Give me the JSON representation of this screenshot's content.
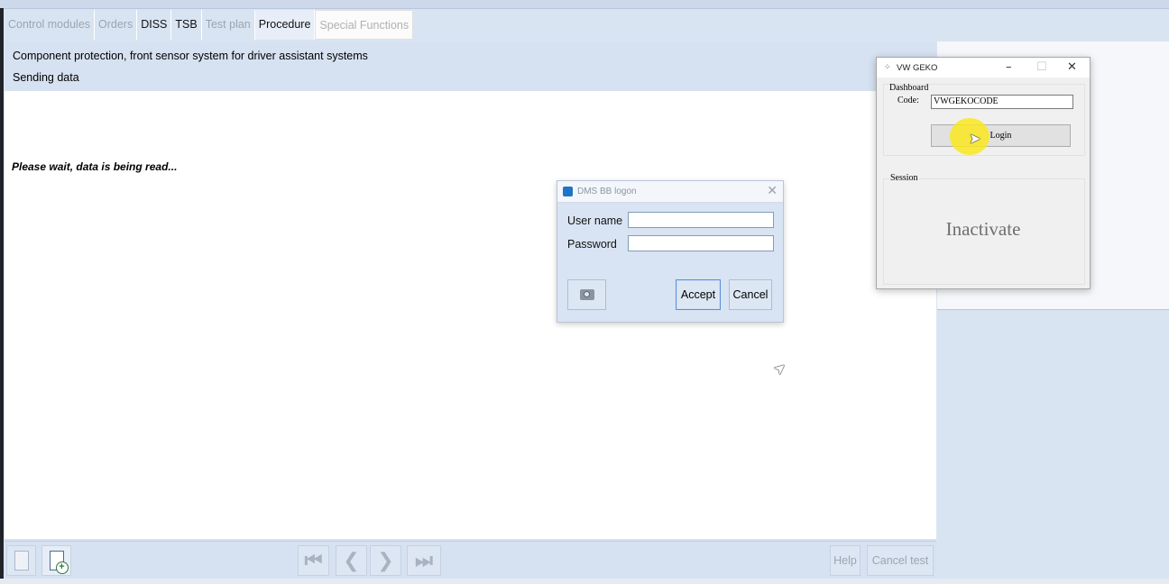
{
  "tabs": [
    {
      "label": "Control modules",
      "state": "disabled"
    },
    {
      "label": "Orders",
      "state": "disabled"
    },
    {
      "label": "DISS",
      "state": "enabled"
    },
    {
      "label": "TSB",
      "state": "enabled"
    },
    {
      "label": "Test plan",
      "state": "disabled"
    },
    {
      "label": "Procedure",
      "state": "active"
    },
    {
      "label": "Special Functions",
      "state": "disabled"
    }
  ],
  "header": {
    "line1": "Component protection, front sensor system for driver assistant systems",
    "line2": "Sending data"
  },
  "content": {
    "wait_message": "Please wait, data is being read..."
  },
  "toolbar": {
    "help_label": "Help",
    "cancel_test_label": "Cancel test"
  },
  "dms_dialog": {
    "title": "DMS BB logon",
    "username_label": "User name",
    "username_value": "",
    "password_label": "Password",
    "password_value": "",
    "accept_label": "Accept",
    "cancel_label": "Cancel"
  },
  "geko_window": {
    "title": "VW GEKO",
    "dashboard_label": "Dashboard",
    "code_label": "Code:",
    "code_value": "VWGEKOCODE",
    "login_label": "Login",
    "session_label": "Session",
    "status_text": "Inactivate"
  },
  "colors": {
    "background": "#d9e4f2",
    "accent_blue": "#1e74c6",
    "highlight_yellow": "#fae81e"
  }
}
